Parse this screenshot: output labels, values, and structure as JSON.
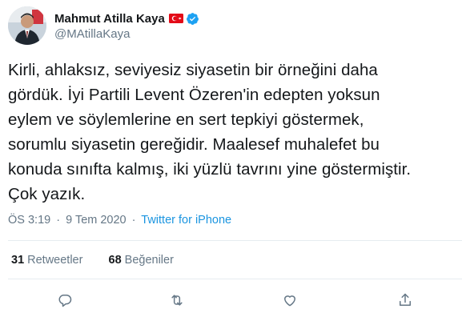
{
  "author": {
    "display_name": "Mahmut Atilla Kaya",
    "handle": "@MAtillaKaya",
    "flag_icon": "turkey-flag-icon",
    "verified_icon": "verified-badge-icon"
  },
  "tweet": {
    "text": "Kirli, ahlaksız, seviyesiz siyasetin bir örneğini daha\ngördük. İyi Partili Levent Özeren'in edepten yoksun\neylem ve söylemlerine en sert tepkiyi göstermek,\nsorumlu siyasetin gereğidir. Maalesef muhalefet bu\nkonuda sınıfta kalmış, iki yüzlü tavrını yine göstermiştir.\nÇok yazık.",
    "time": "ÖS 3:19",
    "date": "9 Tem 2020",
    "separator": "·",
    "source": "Twitter for iPhone"
  },
  "stats": {
    "retweets_count": "31",
    "retweets_label": "Retweetler",
    "likes_count": "68",
    "likes_label": "Beğeniler"
  },
  "actions": [
    {
      "name": "reply",
      "icon": "reply-icon"
    },
    {
      "name": "retweet",
      "icon": "retweet-icon"
    },
    {
      "name": "like",
      "icon": "heart-icon"
    },
    {
      "name": "share",
      "icon": "share-icon"
    }
  ],
  "colors": {
    "primary_text": "#14171a",
    "secondary_text": "#657786",
    "link": "#1b95e0",
    "verified": "#1da1f2",
    "flag_red": "#e30a17",
    "divider": "#e6ecf0"
  }
}
